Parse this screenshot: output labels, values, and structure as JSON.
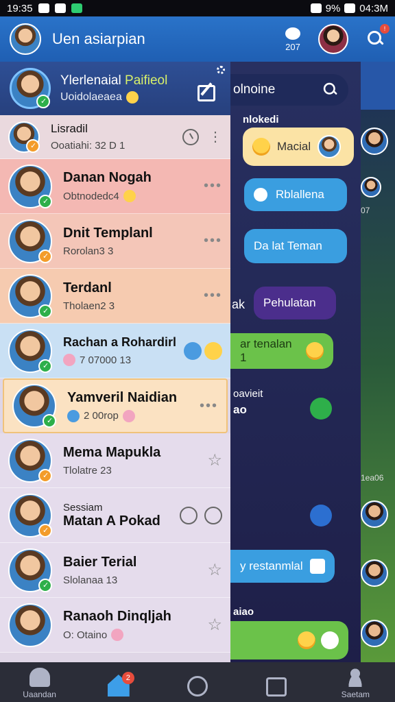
{
  "statusbar": {
    "time": "19:35",
    "battery": "9%",
    "clock": "04:3M"
  },
  "appbar": {
    "title": "Uen asiarpian",
    "count": "207",
    "search_badge": "!"
  },
  "drawer": {
    "header_name": "Ylerlenaial",
    "header_name_accent": "Paifieol",
    "header_sub": "Uoidolaeaea"
  },
  "contacts": [
    {
      "pre": "Lisradil",
      "name": "",
      "sub": "Ooatiahi: 32 D 1"
    },
    {
      "pre": "",
      "name": "Danan Nogah",
      "sub": "Obtnodedc4"
    },
    {
      "pre": "",
      "name": "Dnit Templanl",
      "sub": "Rorolan3 3"
    },
    {
      "pre": "",
      "name": "Terdanl",
      "sub": "Tholaen2 3"
    },
    {
      "pre": "",
      "name": "Rachan a Rohardirl",
      "sub": "7 07000 13"
    },
    {
      "pre": "",
      "name": "Yamveril Naidian",
      "sub": "2 00rop"
    },
    {
      "pre": "",
      "name": "Mema Mapukla",
      "sub": "Tlolatre 23"
    },
    {
      "pre": "Sessiam",
      "name": "Matan A Pokad",
      "sub": ""
    },
    {
      "pre": "",
      "name": "Baier Terial",
      "sub": "Slolanaa 13"
    },
    {
      "pre": "",
      "name": "Ranaoh Dinqljah",
      "sub": "O: Otaino"
    }
  ],
  "chat": {
    "search_text": "olnoine",
    "label_top": "nlokedi",
    "bubble1": "Macial",
    "bubble2": "Rblallena",
    "bubble3": "Da lat Teman",
    "left_label": "ak",
    "bubble4": "Pehulatan",
    "bubble5": "ar tenalan 1",
    "mid_label_1": "oavieit",
    "mid_label_2": "ao",
    "bubble6": "y restanmlal",
    "bottom_label": "aiao"
  },
  "strip": {
    "number": "07",
    "label": "1ea06"
  },
  "nav": {
    "items": [
      {
        "label": "Uaandan",
        "icon": "ghost-icon"
      },
      {
        "label": "",
        "icon": "home-icon"
      },
      {
        "label": "",
        "icon": "circle-icon"
      },
      {
        "label": "",
        "icon": "frame-icon"
      },
      {
        "label": "Saetam",
        "icon": "person-icon"
      }
    ],
    "home_badge": "2"
  }
}
